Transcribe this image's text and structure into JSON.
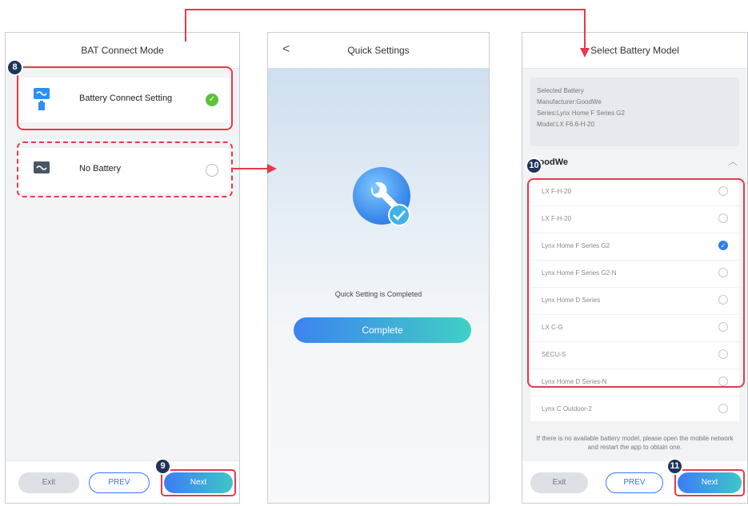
{
  "panel1": {
    "title": "BAT Connect Mode",
    "options": [
      {
        "label": "Battery Connect Setting",
        "selected": true
      },
      {
        "label": "No Battery",
        "selected": false
      }
    ],
    "footer": {
      "exit": "Exit",
      "prev": "PREV",
      "next": "Next"
    },
    "badges": {
      "option": "8",
      "next": "9"
    }
  },
  "panel2": {
    "back": "<",
    "title": "Quick Settings",
    "message": "Quick Setting is Completed",
    "complete": "Complete"
  },
  "panel3": {
    "title": "Select Battery Model",
    "selected_info": {
      "heading": "Selected Battery",
      "manufacturer": "Manufacturer:GoodWe",
      "series": "Series:Lynx Home F Series G2",
      "model": "Model:LX F6.6-H-20"
    },
    "group": "GoodWe",
    "batteries": [
      {
        "name": "LX F-H-20",
        "selected": false
      },
      {
        "name": "LX F-H-20",
        "selected": false
      },
      {
        "name": "Lynx Home F Series G2",
        "selected": true
      },
      {
        "name": "Lynx Home F Series G2-N",
        "selected": false
      },
      {
        "name": "Lynx Home D Series",
        "selected": false
      },
      {
        "name": "LX C-G",
        "selected": false
      },
      {
        "name": "SECU-S",
        "selected": false
      },
      {
        "name": "Lynx Home D Series-N",
        "selected": false
      },
      {
        "name": "Lynx C Outdoor-2",
        "selected": false
      }
    ],
    "hint": "If there is no available battery model, please open the mobile network and restart the app to obtain one.",
    "footer": {
      "exit": "Exit",
      "prev": "PREV",
      "next": "Next"
    },
    "badges": {
      "list": "10",
      "next": "11"
    }
  },
  "colors": {
    "accent": "#3a78f2",
    "highlight": "#e53a4c",
    "check": "#5fbf3b"
  }
}
